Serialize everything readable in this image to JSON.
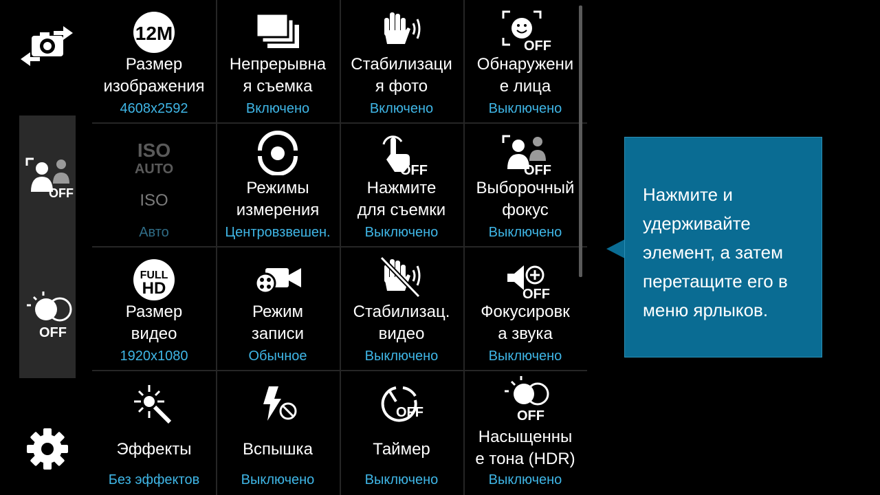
{
  "left_rail": {
    "switch_camera_icon": "camera-switch-icon",
    "shortcut_1_icon": "selective-focus-icon",
    "shortcut_1_badge": "OFF",
    "shortcut_2_icon": "hdr-icon",
    "shortcut_2_badge": "OFF",
    "settings_icon": "gear-icon"
  },
  "badge_off": "OFF",
  "badges": {
    "resolution": "12M",
    "iso_top": "ISO",
    "iso_bottom": "AUTO",
    "full": "FULL",
    "hd": "HD"
  },
  "settings": [
    {
      "id": "picture-size",
      "label": "Размер\nизображения",
      "value": "4608x2592",
      "icon": "resolution-12m-icon"
    },
    {
      "id": "burst-shot",
      "label": "Непрерывна\nя съемка",
      "value": "Включено",
      "icon": "burst-shot-icon"
    },
    {
      "id": "photo-stabilization",
      "label": "Стабилизаци\nя фото",
      "value": "Включено",
      "icon": "stabilization-hand-icon"
    },
    {
      "id": "face-detection",
      "label": "Обнаружени\nе лица",
      "value": "Выключено",
      "icon": "face-detection-icon"
    },
    {
      "id": "iso",
      "label": "ISO",
      "value": "Авто",
      "icon": "iso-auto-icon",
      "disabled": true
    },
    {
      "id": "metering",
      "label": "Режимы\nизмерения",
      "value": "Центровзвешен.",
      "icon": "metering-icon"
    },
    {
      "id": "tap-to-shoot",
      "label": "Нажмите\nдля съемки",
      "value": "Выключено",
      "icon": "tap-to-shoot-icon"
    },
    {
      "id": "selective-focus",
      "label": "Выборочный\nфокус",
      "value": "Выключено",
      "icon": "selective-focus-icon"
    },
    {
      "id": "video-size",
      "label": "Размер\nвидео",
      "value": "1920x1080",
      "icon": "full-hd-icon"
    },
    {
      "id": "recording-mode",
      "label": "Режим\nзаписи",
      "value": "Обычное",
      "icon": "video-camera-icon"
    },
    {
      "id": "video-stabilization",
      "label": "Стабилизац.\nвидео",
      "value": "Выключено",
      "icon": "video-stabilization-off-icon"
    },
    {
      "id": "audio-zoom",
      "label": "Фокусировк\nа звука",
      "value": "Выключено",
      "icon": "audio-zoom-icon"
    },
    {
      "id": "effects",
      "label": "Эффекты",
      "value": "Без эффектов",
      "icon": "magic-wand-icon"
    },
    {
      "id": "flash",
      "label": "Вспышка",
      "value": "Выключено",
      "icon": "flash-off-icon"
    },
    {
      "id": "timer",
      "label": "Таймер",
      "value": "Выключено",
      "icon": "timer-icon"
    },
    {
      "id": "rich-tone",
      "label": "Насыщенны\nе тона (HDR)",
      "value": "Выключено",
      "icon": "hdr-icon"
    }
  ],
  "tooltip": {
    "text": "Нажмите и\nудерживайте\nэлемент, а затем\nперетащите его в\nменю ярлыков."
  }
}
